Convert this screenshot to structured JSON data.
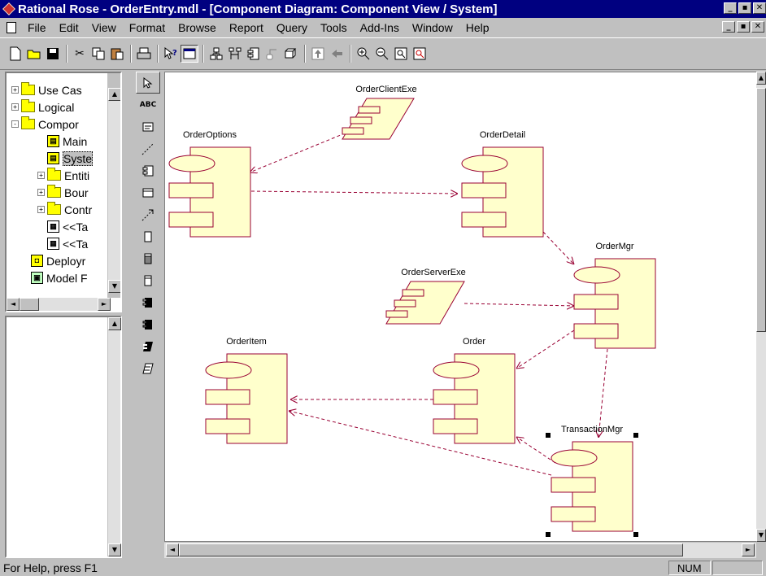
{
  "window": {
    "title": "Rational Rose - OrderEntry.mdl - [Component Diagram: Component View / System]",
    "min_label": "_",
    "restore_label": "▪",
    "close_label": "✕"
  },
  "menubar": {
    "items": [
      {
        "label": "File"
      },
      {
        "label": "Edit"
      },
      {
        "label": "View"
      },
      {
        "label": "Format"
      },
      {
        "label": "Browse"
      },
      {
        "label": "Report"
      },
      {
        "label": "Query"
      },
      {
        "label": "Tools"
      },
      {
        "label": "Add-Ins"
      },
      {
        "label": "Window"
      },
      {
        "label": "Help"
      }
    ]
  },
  "toolbar": {
    "icons": [
      "new-icon",
      "open-icon",
      "save-icon",
      "cut-icon",
      "copy-icon",
      "paste-icon",
      "print-icon",
      "context-help-icon",
      "view-documentation-icon",
      "browse-class-diagram-icon",
      "browse-interaction-diagram-icon",
      "browse-component-diagram-icon",
      "browse-state-diagram-icon",
      "browse-deployment-diagram-icon",
      "browse-parent-icon",
      "browse-previous-icon",
      "zoom-in-icon",
      "zoom-out-icon",
      "fit-in-window-icon",
      "undo-fit-icon"
    ]
  },
  "browser": {
    "rows": [
      {
        "label": "Use Cas",
        "kind": "folder",
        "expander": "+",
        "indent": 0
      },
      {
        "label": "Logical",
        "kind": "folder",
        "expander": "+",
        "indent": 0
      },
      {
        "label": "Compor",
        "kind": "folder",
        "expander": "-",
        "indent": 0
      },
      {
        "label": "Main",
        "kind": "diagram",
        "expander": "",
        "indent": 1
      },
      {
        "label": "Syste",
        "kind": "diagram",
        "expander": "",
        "indent": 1,
        "selected": true
      },
      {
        "label": "Entiti",
        "kind": "folder",
        "expander": "+",
        "indent": 1
      },
      {
        "label": "Bour",
        "kind": "folder",
        "expander": "+",
        "indent": 1
      },
      {
        "label": "Contr",
        "kind": "folder",
        "expander": "+",
        "indent": 1
      },
      {
        "label": "<<Ta",
        "kind": "component",
        "expander": "",
        "indent": 1
      },
      {
        "label": "<<Ta",
        "kind": "component",
        "expander": "",
        "indent": 1
      },
      {
        "label": "Deployr",
        "kind": "deploy",
        "expander": "",
        "indent": 0
      },
      {
        "label": "Model F",
        "kind": "model",
        "expander": "",
        "indent": 0
      }
    ]
  },
  "toolbox": {
    "tools": [
      "selection-icon",
      "text-icon",
      "note-icon",
      "anchor-note-icon",
      "package-icon",
      "component-icon",
      "dependency-icon",
      "subprogram-spec-icon",
      "subprogram-body-icon",
      "main-program-icon",
      "package-spec-icon",
      "package-body-icon",
      "task-spec-icon",
      "task-body-icon"
    ],
    "text_label": "ABC"
  },
  "diagram": {
    "components": [
      {
        "id": "OrderClientExe",
        "label": "OrderClientExe",
        "kind": "executable"
      },
      {
        "id": "OrderOptions",
        "label": "OrderOptions",
        "kind": "component"
      },
      {
        "id": "OrderDetail",
        "label": "OrderDetail",
        "kind": "component"
      },
      {
        "id": "OrderMgr",
        "label": "OrderMgr",
        "kind": "component"
      },
      {
        "id": "OrderServerExe",
        "label": "OrderServerExe",
        "kind": "executable"
      },
      {
        "id": "OrderItem",
        "label": "OrderItem",
        "kind": "component"
      },
      {
        "id": "Order",
        "label": "Order",
        "kind": "component"
      },
      {
        "id": "TransactionMgr",
        "label": "TransactionMgr",
        "kind": "component",
        "selected": true
      }
    ],
    "dependencies": [
      {
        "from": "OrderClientExe",
        "to": "OrderOptions"
      },
      {
        "from": "OrderOptions",
        "to": "OrderDetail"
      },
      {
        "from": "OrderDetail",
        "to": "OrderMgr"
      },
      {
        "from": "OrderServerExe",
        "to": "OrderMgr"
      },
      {
        "from": "OrderMgr",
        "to": "Order"
      },
      {
        "from": "OrderMgr",
        "to": "TransactionMgr"
      },
      {
        "from": "Order",
        "to": "OrderItem"
      },
      {
        "from": "TransactionMgr",
        "to": "OrderItem"
      },
      {
        "from": "TransactionMgr",
        "to": "Order"
      }
    ],
    "colors": {
      "fill": "#ffffcc",
      "stroke": "#990033",
      "arrow": "#990033"
    }
  },
  "statusbar": {
    "help_text": "For Help, press F1",
    "num": "NUM"
  }
}
